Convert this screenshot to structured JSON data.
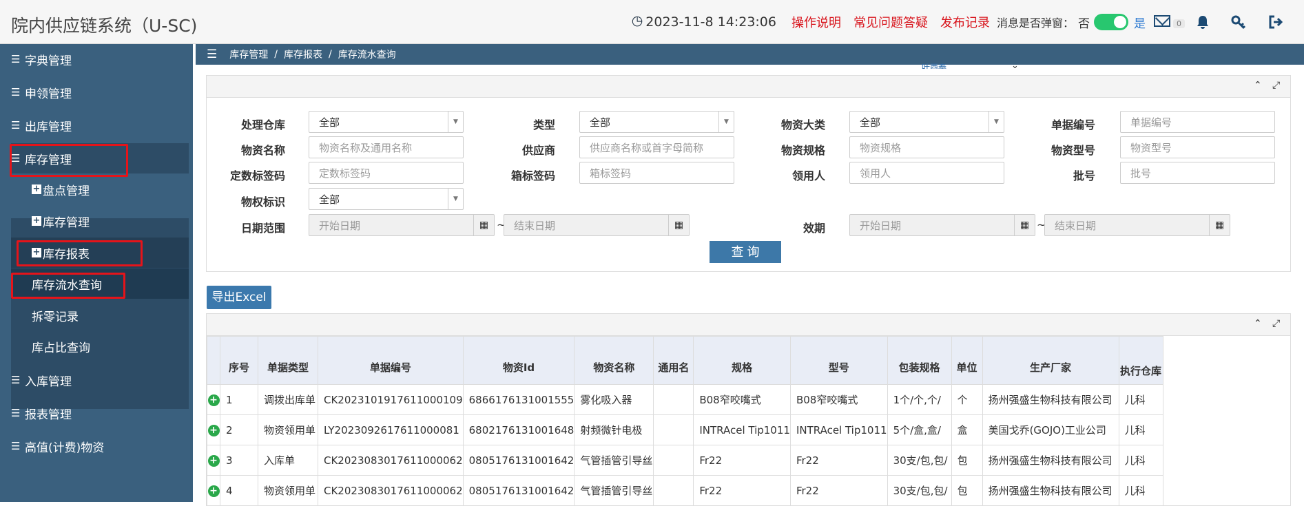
{
  "header": {
    "app_title": "院内供应链系统（U-SC)",
    "datetime": "2023-11-8  14:23:06",
    "links": [
      "操作说明",
      "常见问题答疑",
      "发布记录"
    ],
    "popup_label": "消息是否弹窗：",
    "toggle_off_label": "否",
    "toggle_on_label": "是",
    "toggle_state": "on",
    "mail_count": "0",
    "icons": [
      "clock-icon",
      "mail-icon",
      "bell-icon",
      "key-icon",
      "logout-icon"
    ]
  },
  "sidebar": {
    "menus": [
      "字典管理",
      "申领管理",
      "出库管理",
      "库存管理"
    ],
    "submenus": [
      "盘点管理",
      "库存管理",
      "库存报表",
      "库存流水查询",
      "拆零记录",
      "库占比查询"
    ],
    "menus_bottom": [
      "入库管理",
      "报表管理",
      "高值(计费)物资"
    ]
  },
  "breadcrumb": [
    "库存管理",
    "库存报表",
    "库存流水查询"
  ],
  "cut_text": "叶酉秦",
  "query": {
    "warehouse_label": "处理仓库",
    "warehouse_value": "全部",
    "type_label": "类型",
    "type_value": "全部",
    "category_label": "物资大类",
    "category_value": "全部",
    "docno_label": "单据编号",
    "docno_placeholder": "单据编号",
    "name_label": "物资名称",
    "name_placeholder": "物资名称及通用名称",
    "supplier_label": "供应商",
    "supplier_placeholder": "供应商名称或首字母简称",
    "spec_label": "物资规格",
    "spec_placeholder": "物资规格",
    "model_label": "物资型号",
    "model_placeholder": "物资型号",
    "fixed_tag_label": "定数标签码",
    "fixed_tag_placeholder": "定数标签码",
    "box_tag_label": "箱标签码",
    "box_tag_placeholder": "箱标签码",
    "receiver_label": "领用人",
    "receiver_placeholder": "领用人",
    "batch_label": "批号",
    "batch_placeholder": "批号",
    "ownership_label": "物权标识",
    "ownership_value": "全部",
    "date_label": "日期范围",
    "start_placeholder": "开始日期",
    "end_placeholder": "结束日期",
    "expiry_label": "效期",
    "expiry_start_placeholder": "开始日期",
    "expiry_end_placeholder": "结束日期",
    "tilde": "~",
    "search_button": "查 询"
  },
  "export_button": "导出Excel",
  "table": {
    "columns": [
      "",
      "序号",
      "单据类型",
      "单据编号",
      "物资Id",
      "物资名称",
      "通用名",
      "规格",
      "型号",
      "包装规格",
      "单位",
      "生产厂家",
      "执行仓库"
    ],
    "rows": [
      [
        "1",
        "调拨出库单",
        "CK2023101917611000109",
        "6866176131001555",
        "雾化吸入器",
        "",
        "B08窄咬嘴式",
        "B08窄咬嘴式",
        "1个/个,个/",
        "个",
        "扬州强盛生物科技有限公司",
        "儿科"
      ],
      [
        "2",
        "物资领用单",
        "LY2023092617611000081",
        "6802176131001648",
        "射频微针电极",
        "",
        "INTRAcel Tip1011",
        "INTRAcel Tip1011",
        "5个/盒,盒/",
        "盒",
        "美国戈乔(GOJO)工业公司",
        "儿科"
      ],
      [
        "3",
        "入库单",
        "CK2023083017611000062",
        "0805176131001642",
        "气管插管引导丝",
        "",
        "Fr22",
        "Fr22",
        "30支/包,包/",
        "包",
        "扬州强盛生物科技有限公司",
        "儿科"
      ],
      [
        "4",
        "物资领用单",
        "CK2023083017611000062",
        "0805176131001642",
        "气管插管引导丝",
        "",
        "Fr22",
        "Fr22",
        "30支/包,包/",
        "包",
        "扬州强盛生物科技有限公司",
        "儿科"
      ]
    ]
  }
}
